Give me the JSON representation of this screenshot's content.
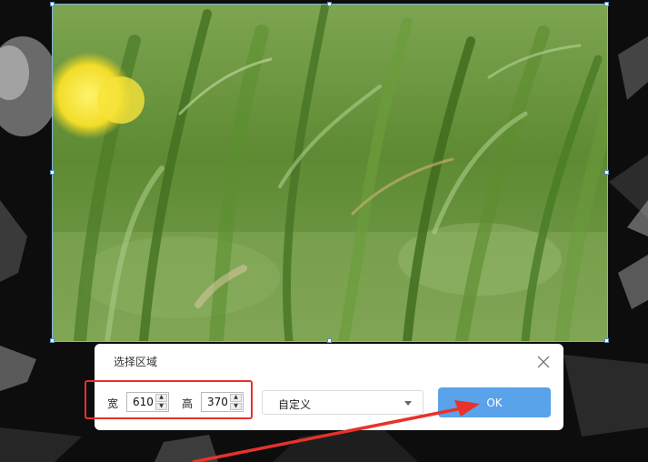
{
  "dialog": {
    "title": "选择区域",
    "width_label": "宽",
    "width_value": "610",
    "height_label": "高",
    "height_value": "370",
    "preset_value": "自定义",
    "ok_label": "OK"
  },
  "colors": {
    "accent": "#5aa2ea",
    "annotation_red": "#e8322a",
    "selection_border": "#7fb3d9",
    "grass_green": "#6d9440",
    "flower_yellow": "#f2dd2a"
  },
  "icons": [
    "close-icon",
    "spin-up-icon",
    "spin-down-icon",
    "chevron-down-icon",
    "arrow-annotation"
  ]
}
